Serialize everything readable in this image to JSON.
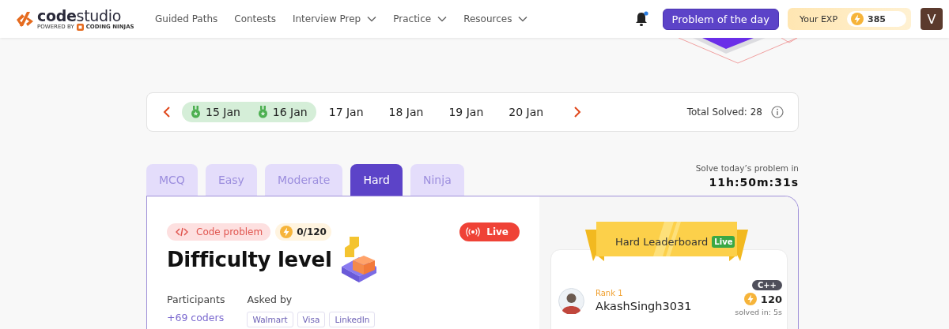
{
  "header": {
    "logo": {
      "name": "**code**studio",
      "powered_by": "POWERED BY",
      "brand": "CODING NINJAS"
    },
    "nav": [
      {
        "label": "Guided Paths",
        "dropdown": false
      },
      {
        "label": "Contests",
        "dropdown": false
      },
      {
        "label": "Interview Prep",
        "dropdown": true
      },
      {
        "label": "Practice",
        "dropdown": true
      },
      {
        "label": "Resources",
        "dropdown": true
      }
    ],
    "notification": {
      "unread": true
    },
    "problem_of_the_day": "Problem of the day",
    "exp": {
      "label": "Your EXP",
      "value": "385"
    },
    "avatar": "V"
  },
  "dates": {
    "items": [
      {
        "label": "15 Jan",
        "solved": true
      },
      {
        "label": "16 Jan",
        "solved": true
      },
      {
        "label": "17 Jan",
        "solved": false
      },
      {
        "label": "18 Jan",
        "solved": false
      },
      {
        "label": "19 Jan",
        "solved": false
      },
      {
        "label": "20 Jan",
        "solved": false
      }
    ],
    "total_solved": "Total Solved: 28"
  },
  "tabs": [
    {
      "label": "MCQ",
      "selected": false
    },
    {
      "label": "Easy",
      "selected": false
    },
    {
      "label": "Moderate",
      "selected": false
    },
    {
      "label": "Hard",
      "selected": true
    },
    {
      "label": "Ninja",
      "selected": false
    }
  ],
  "timer": {
    "caption": "Solve today’s problem in",
    "value": "11h:50m:31s"
  },
  "problem": {
    "type_tag": "Code problem",
    "points": "0/120",
    "live": "Live",
    "title": "Difficulty level",
    "participants_label": "Participants",
    "participants": "+69 coders",
    "asked_by_label": "Asked by",
    "companies": [
      "Walmart",
      "Visa",
      "LinkedIn"
    ]
  },
  "leaderboard": {
    "title": "Hard Leaderboard",
    "badge": "Live",
    "entries": [
      {
        "rank": "Rank 1",
        "user": "AkashSingh3031",
        "language": "C++",
        "points": "120",
        "solved_in": "solved in: 5s"
      }
    ]
  }
}
